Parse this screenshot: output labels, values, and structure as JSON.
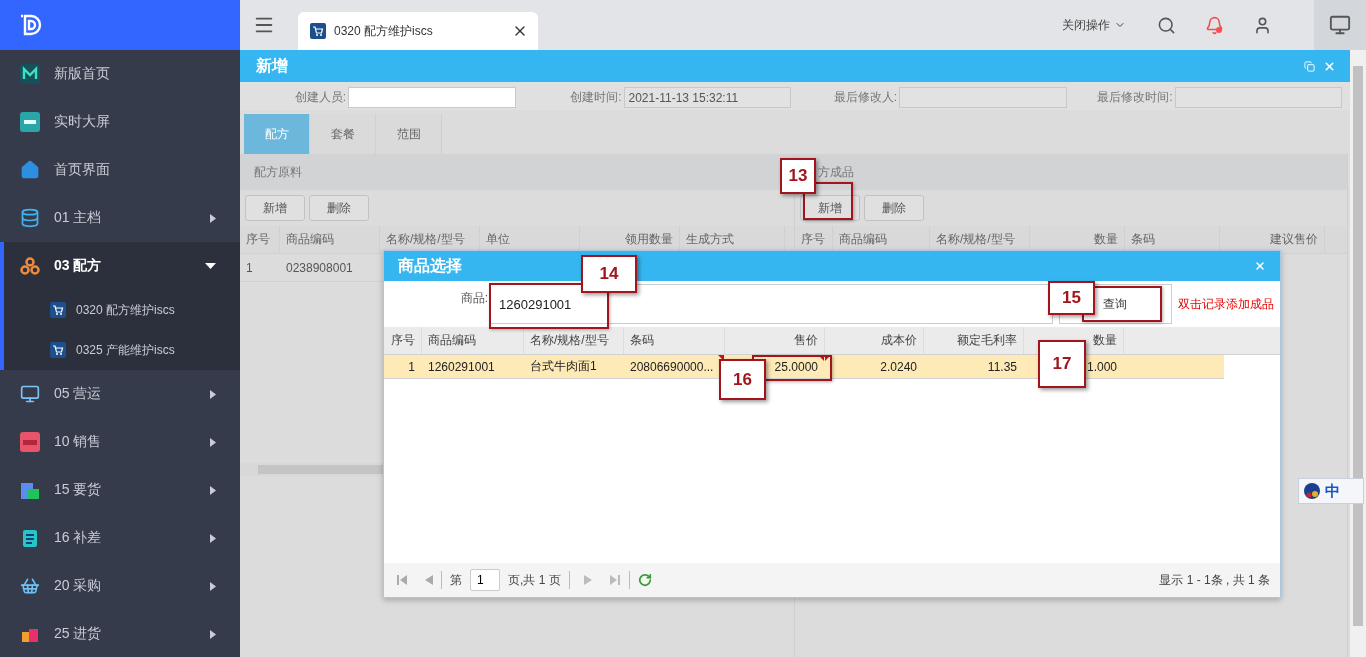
{
  "sidebar": {
    "items": [
      {
        "label": "新版首页",
        "selected": false
      },
      {
        "label": "实时大屏",
        "selected": false
      },
      {
        "label": "首页界面",
        "selected": false
      },
      {
        "label": "01 主档",
        "selected": false,
        "expanded": false
      },
      {
        "label": "03 配方",
        "selected": true,
        "expanded": true,
        "children": [
          {
            "label": "0320 配方维护iscs",
            "selected": false
          },
          {
            "label": "0325 产能维护iscs",
            "selected": false
          }
        ]
      },
      {
        "label": "05 营运",
        "selected": false,
        "expanded": false
      },
      {
        "label": "10 销售",
        "selected": false,
        "expanded": false
      },
      {
        "label": "15 要货",
        "selected": false,
        "expanded": false
      },
      {
        "label": "16 补差",
        "selected": false,
        "expanded": false
      },
      {
        "label": "20 采购",
        "selected": false,
        "expanded": false
      },
      {
        "label": "25 进货",
        "selected": false,
        "expanded": false
      }
    ]
  },
  "topbar": {
    "tabs": [
      {
        "label": "0320 配方维护iscs",
        "selected": true
      }
    ],
    "actions_menu": "关闭操作",
    "notification": true
  },
  "panel": {
    "title": "新增",
    "info_fields": [
      {
        "label": "创建人员:",
        "redacted": true
      },
      {
        "label": "创建时间:",
        "value": "2021-11-13 15:32:11",
        "redacted": false
      },
      {
        "label": "最后修改人:",
        "redacted": false
      },
      {
        "label": "最后修改时间:",
        "redacted": false
      }
    ],
    "tabs": [
      {
        "label": "配方",
        "selected": true
      },
      {
        "label": "套餐",
        "selected": false
      },
      {
        "label": "范围",
        "selected": false
      }
    ],
    "sections": [
      {
        "title": "配方原料",
        "buttons": [
          "新增",
          "删除"
        ],
        "columns": [
          "序号",
          "商品编码",
          "名称/规格/型号",
          "单位",
          "领用数量",
          "生成方式"
        ],
        "rows": [
          [
            "1",
            "0238908001"
          ]
        ]
      },
      {
        "title": "方成品",
        "buttons": [
          "新增",
          "删除"
        ],
        "columns": [
          "序号",
          "商品编码",
          "名称/规格/型号",
          "数量",
          "条码",
          "建议售价"
        ]
      }
    ]
  },
  "dialog": {
    "title": "商品选择",
    "search_label": "商品:",
    "search_value": "1260291001",
    "search_button": "查询",
    "hint": "双击记录添加成品",
    "columns": [
      "序号",
      "商品编码",
      "名称/规格/型号",
      "条码",
      "售价",
      "成本价",
      "额定毛利率",
      "数量"
    ],
    "rows": [
      {
        "selected": true,
        "cells": [
          "1",
          "1260291001",
          "台式牛肉面1",
          "20806690000...",
          "25.0000",
          "2.0240",
          "11.35",
          "1.000"
        ]
      }
    ],
    "pager": {
      "page_label": "第",
      "page": "1",
      "total_pages": "页,共 1 页",
      "summary": "显示 1 - 1条 , 共 1 条"
    }
  },
  "callouts": [
    {
      "label": "13"
    },
    {
      "label": "14"
    },
    {
      "label": "15"
    },
    {
      "label": "16"
    },
    {
      "label": "17"
    }
  ],
  "ime": {
    "mode": "中"
  }
}
